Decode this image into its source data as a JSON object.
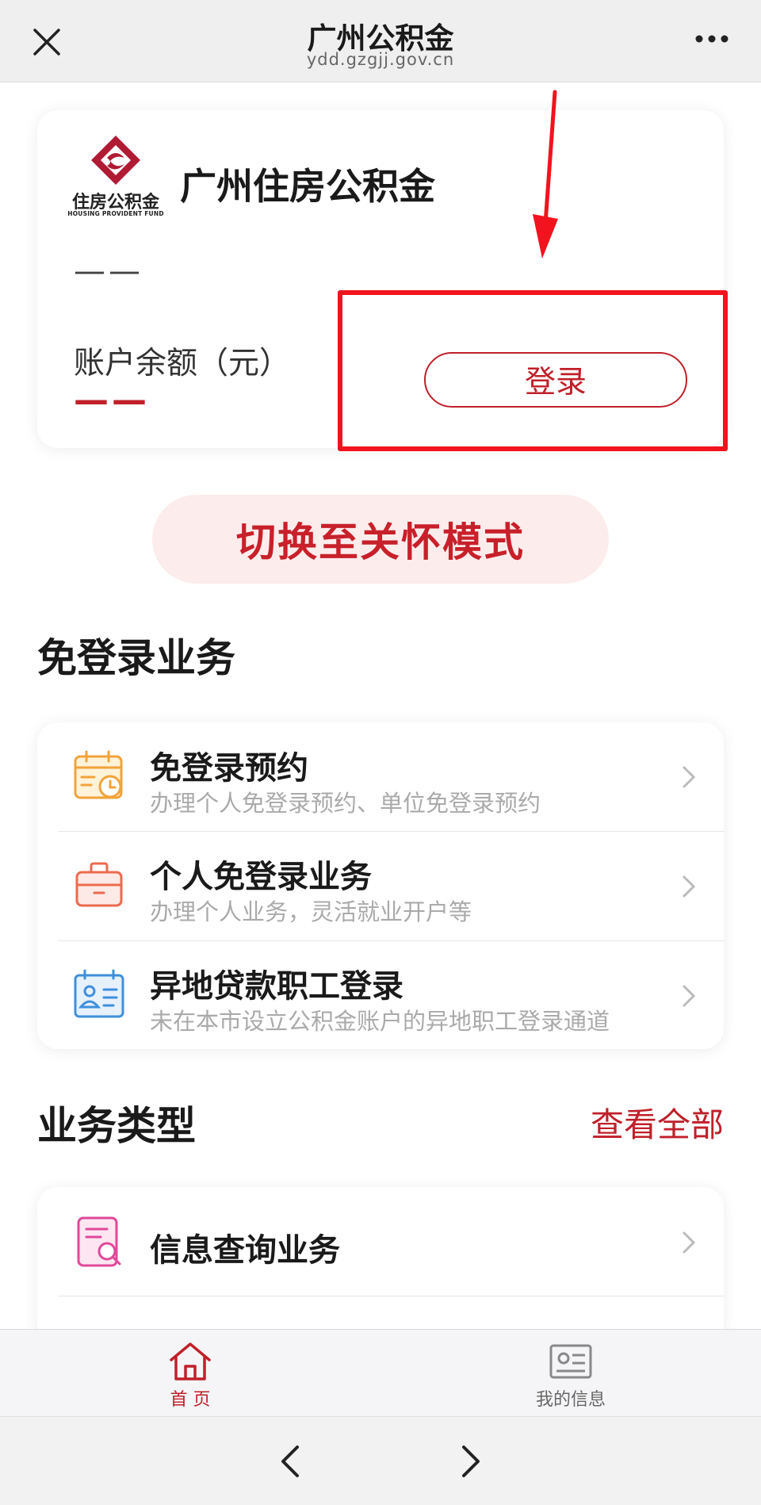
{
  "topbar": {
    "title": "广州公积金",
    "domain": "ydd.gzgjj.gov.cn",
    "close_icon": "close-icon",
    "more_icon": "more-icon"
  },
  "account_card": {
    "logo_text": "住房公积金",
    "logo_text_en": "HOUSING PROVIDENT FUND",
    "org_name": "广州住房公积金",
    "name_value": "——",
    "balance_label": "账户余额（元）",
    "balance_value": "——",
    "login_label": "登录"
  },
  "care_mode_label": "切换至关怀模式",
  "no_login_section": {
    "title": "免登录业务",
    "items": [
      {
        "title": "免登录预约",
        "desc": "办理个人免登录预约、单位免登录预约",
        "icon": "calendar-clock-icon"
      },
      {
        "title": "个人免登录业务",
        "desc": "办理个人业务，灵活就业开户等",
        "icon": "briefcase-icon"
      },
      {
        "title": "异地贷款职工登录",
        "desc": "未在本市设立公积金账户的异地职工登录通道",
        "icon": "id-card-icon"
      }
    ]
  },
  "business_section": {
    "title": "业务类型",
    "view_all": "查看全部",
    "items": [
      {
        "title": "信息查询业务",
        "icon": "document-search-icon"
      }
    ]
  },
  "tabbar": {
    "tabs": [
      {
        "label": "首 页",
        "icon": "home-icon",
        "active": true
      },
      {
        "label": "我的信息",
        "icon": "profile-card-icon",
        "active": false
      }
    ]
  },
  "colors": {
    "accent": "#c0202a",
    "highlight": "#f2131e",
    "care_bg": "#fdecec"
  }
}
